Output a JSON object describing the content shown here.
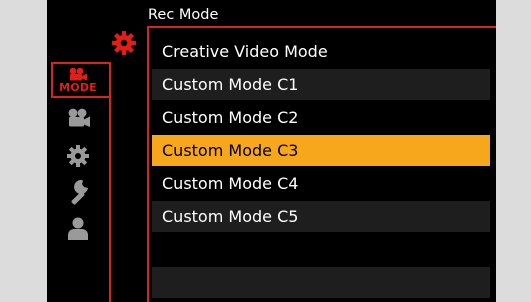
{
  "menu": {
    "title": "Rec Mode",
    "items": [
      {
        "label": "Creative Video Mode"
      },
      {
        "label": "Custom Mode C1"
      },
      {
        "label": "Custom Mode C2"
      },
      {
        "label": "Custom Mode C3",
        "selected": true
      },
      {
        "label": "Custom Mode C4"
      },
      {
        "label": "Custom Mode C5"
      }
    ]
  },
  "tabs": {
    "mode_label": "MODE",
    "icons": [
      "video-camera-mode-icon",
      "video-camera-icon",
      "gear-icon",
      "wrench-icon",
      "person-icon"
    ]
  },
  "colors": {
    "accent_red": "#d6261b",
    "selected_orange": "#f6a71c",
    "screen_bg": "#000000",
    "border_bg": "#dcdcdc"
  }
}
